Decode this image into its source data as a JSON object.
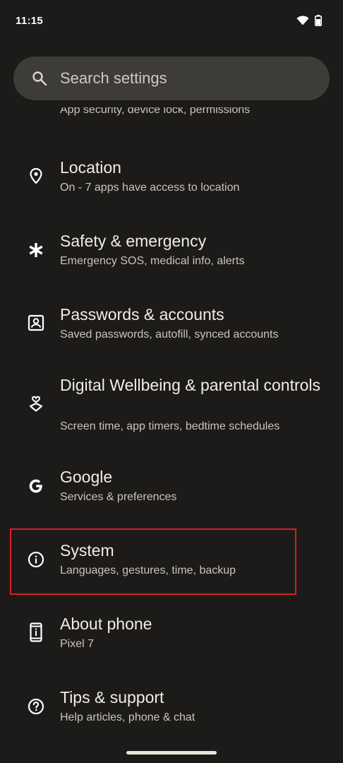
{
  "status_bar": {
    "time": "11:15",
    "icons": [
      "wifi-icon",
      "battery-icon"
    ]
  },
  "search": {
    "placeholder": "Search settings",
    "icon": "search-icon"
  },
  "partial_item": {
    "subtitle": "App security, device lock, permissions"
  },
  "items": [
    {
      "title": "Location",
      "subtitle": "On - 7 apps have access to location",
      "icon": "location-pin-icon"
    },
    {
      "title": "Safety & emergency",
      "subtitle": "Emergency SOS, medical info, alerts",
      "icon": "asterisk-icon"
    },
    {
      "title": "Passwords & accounts",
      "subtitle": "Saved passwords, autofill, synced accounts",
      "icon": "account-box-icon"
    },
    {
      "title": "Digital Wellbeing & parental controls",
      "subtitle": "Screen time, app timers, bedtime schedules",
      "icon": "wellbeing-icon"
    },
    {
      "title": "Google",
      "subtitle": "Services & preferences",
      "icon": "google-icon"
    },
    {
      "title": "System",
      "subtitle": "Languages, gestures, time, backup",
      "icon": "info-icon"
    },
    {
      "title": "About phone",
      "subtitle": "Pixel 7",
      "icon": "phone-info-icon"
    },
    {
      "title": "Tips & support",
      "subtitle": "Help articles, phone & chat",
      "icon": "help-icon"
    }
  ],
  "highlighted_item": "System",
  "colors": {
    "background": "#1c1b19",
    "search_bg": "#3d3c38",
    "highlight": "#e01b22"
  }
}
